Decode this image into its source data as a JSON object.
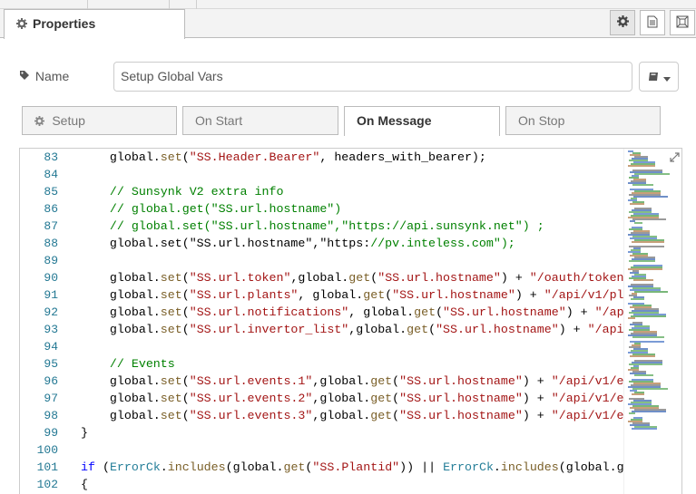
{
  "tabs": {
    "main_label": "Properties"
  },
  "node": {
    "name_label": "Name",
    "name_value": "Setup Global Vars"
  },
  "subtabs": [
    {
      "label": "Setup"
    },
    {
      "label": "On Start"
    },
    {
      "label": "On Message"
    },
    {
      "label": "On Stop"
    }
  ],
  "editor": {
    "line_numbers": [
      "83",
      "84",
      "85",
      "86",
      "87",
      "88",
      "89",
      "90",
      "91",
      "92",
      "93",
      "94",
      "95",
      "96",
      "97",
      "98",
      "99",
      "100",
      "101",
      "102"
    ],
    "lines": [
      "    global.set(\"SS.Header.Bearer\", headers_with_bearer);",
      "",
      "    // Sunsynk V2 extra info",
      "    // global.get(\"SS.url.hostname\")",
      "    // global.set(\"SS.url.hostname\",\"https://api.sunsynk.net\") ;",
      "    global.set(\"SS.url.hostname\",\"https://pv.inteless.com\");",
      "",
      "    global.set(\"SS.url.token\",global.get(\"SS.url.hostname\") + \"/oauth/token",
      "    global.set(\"SS.url.plants\", global.get(\"SS.url.hostname\") + \"/api/v1/pl",
      "    global.set(\"SS.url.notifications\", global.get(\"SS.url.hostname\") + \"/ap",
      "    global.set(\"SS.url.invertor_list\",global.get(\"SS.url.hostname\") + \"/api",
      "",
      "    // Events",
      "    global.set(\"SS.url.events.1\",global.get(\"SS.url.hostname\") + \"/api/v1/e",
      "    global.set(\"SS.url.events.2\",global.get(\"SS.url.hostname\") + \"/api/v1/e",
      "    global.set(\"SS.url.events.3\",global.get(\"SS.url.hostname\") + \"/api/v1/e",
      "}",
      "",
      "if (ErrorCk.includes(global.get(\"SS.Plantid\")) || ErrorCk.includes(global.g",
      "{"
    ]
  },
  "icons": {
    "tab_gear": "gear-icon",
    "info": "book-icon",
    "appearance": "layout-icon",
    "name_tag": "tag-icon",
    "name_dropdown": "book-dropdown-icon",
    "expand": "expand-icon"
  },
  "colors": {
    "keyword": "#0000ff",
    "string": "#a31515",
    "comment": "#008000",
    "function": "#795e26",
    "line_number": "#237893"
  }
}
